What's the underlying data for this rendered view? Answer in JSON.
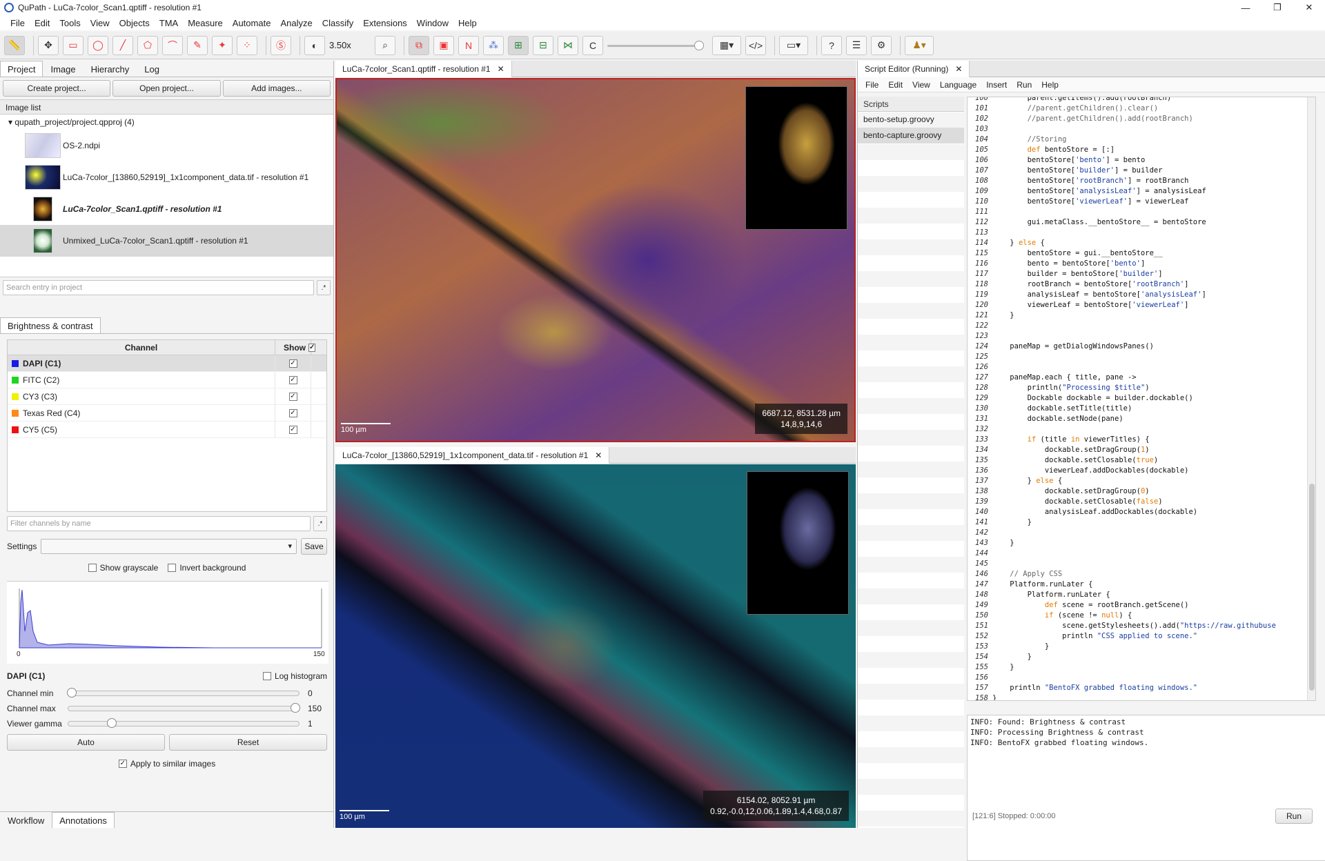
{
  "window": {
    "title": "QuPath - LuCa-7color_Scan1.qptiff - resolution #1"
  },
  "menu": [
    "File",
    "Edit",
    "Tools",
    "View",
    "Objects",
    "TMA",
    "Measure",
    "Automate",
    "Analyze",
    "Classify",
    "Extensions",
    "Window",
    "Help"
  ],
  "toolbar": {
    "zoom": "3.50x",
    "channel_toggle": "C",
    "tool_n": "N"
  },
  "left": {
    "tabs": [
      "Project",
      "Image",
      "Hierarchy",
      "Log"
    ],
    "buttons": {
      "create": "Create project...",
      "open": "Open project...",
      "add": "Add images..."
    },
    "image_list_header": "Image list",
    "project_root": "qupath_project/project.qpproj (4)",
    "images": [
      {
        "name": "OS-2.ndpi"
      },
      {
        "name": "LuCa-7color_[13860,52919]_1x1component_data.tif - resolution #1"
      },
      {
        "name": "LuCa-7color_Scan1.qptiff - resolution #1"
      },
      {
        "name": "Unmixed_LuCa-7color_Scan1.qptiff - resolution #1"
      }
    ],
    "search_placeholder": "Search entry in project",
    "search_btn": ".*"
  },
  "bc": {
    "tab": "Brightness & contrast",
    "col_channel": "Channel",
    "col_show": "Show",
    "channels": [
      {
        "name": "DAPI (C1)",
        "color": "#1a1ae6"
      },
      {
        "name": "FITC (C2)",
        "color": "#22d422"
      },
      {
        "name": "CY3 (C3)",
        "color": "#f0f000"
      },
      {
        "name": "Texas Red (C4)",
        "color": "#ff8a1a"
      },
      {
        "name": "CY5 (C5)",
        "color": "#ee1111"
      }
    ],
    "filter_placeholder": "Filter channels by name",
    "settings_label": "Settings",
    "save": "Save",
    "show_grayscale": "Show grayscale",
    "invert_background": "Invert background",
    "hist_min": "0",
    "hist_max": "150",
    "selected_channel": "DAPI (C1)",
    "log_histogram": "Log histogram",
    "channel_min_label": "Channel min",
    "channel_min": "0",
    "channel_max_label": "Channel max",
    "channel_max": "150",
    "gamma_label": "Viewer gamma",
    "gamma": "1",
    "auto": "Auto",
    "reset": "Reset",
    "apply_similar": "Apply to similar images"
  },
  "bottom_tabs": [
    "Workflow",
    "Annotations"
  ],
  "viewer1": {
    "tab": "LuCa-7color_Scan1.qptiff - resolution #1",
    "coord1": "6687.12, 8531.28 µm",
    "coord2": "14,8,9,14,6",
    "scale": "100 µm"
  },
  "viewer2": {
    "tab": "LuCa-7color_[13860,52919]_1x1component_data.tif - resolution #1",
    "coord1": "6154.02, 8052.91 µm",
    "coord2": "0.92,-0.0,12,0.06,1.89,1.4,4.68,0.87",
    "scale": "100 µm"
  },
  "script_editor": {
    "tab": "Script Editor (Running)",
    "menu": [
      "File",
      "Edit",
      "View",
      "Language",
      "Insert",
      "Run",
      "Help"
    ],
    "scripts_header": "Scripts",
    "scripts": [
      "bento-setup.groovy",
      "bento-capture.groovy"
    ],
    "console": "INFO: Found: Brightness & contrast\nINFO: Processing Brightness & contrast\nINFO: BentoFX grabbed floating windows.",
    "status": "[121:6]   Stopped: 0:00:00",
    "run": "Run"
  }
}
